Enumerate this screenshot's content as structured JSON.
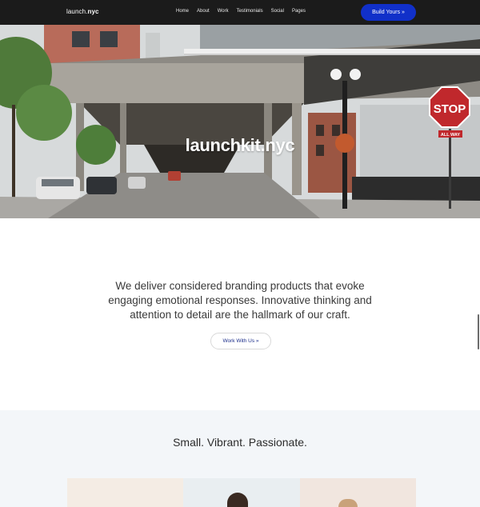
{
  "brand": {
    "name_prefix": "launch.",
    "name_bold": "nyc"
  },
  "nav": {
    "items": [
      "Home",
      "About",
      "Work",
      "Testimonials",
      "Social",
      "Pages"
    ],
    "cta_label": "Build Yours »"
  },
  "hero": {
    "title": "launchkit.nyc",
    "sign_text": "STOP",
    "street_sign": "ALL WAY"
  },
  "intro": {
    "text": "We deliver considered branding products that evoke engaging emotional responses. Innovative thinking and attention to detail are the hallmark of our craft.",
    "button_label": "Work With Us »"
  },
  "section2": {
    "title": "Small. Vibrant. Passionate."
  },
  "colors": {
    "nav_bg": "#1b1b1b",
    "accent": "#1130c9",
    "section_bg": "#f3f6f9"
  }
}
